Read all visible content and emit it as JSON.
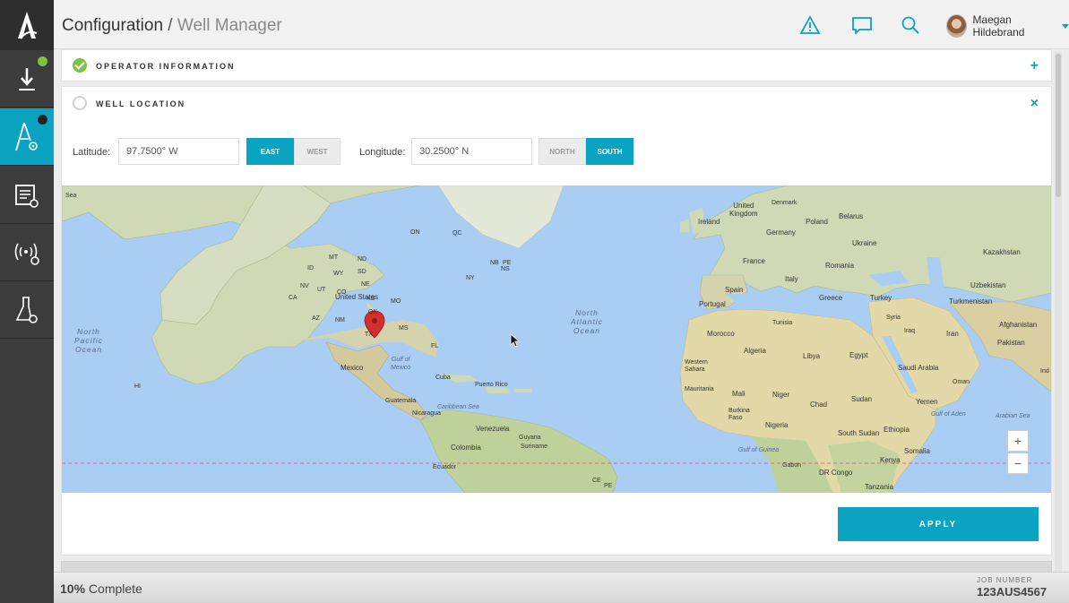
{
  "header": {
    "title_main": "Configuration",
    "title_sep": " / ",
    "title_sub": "Well Manager",
    "user_name": "Maegan Hildebrand",
    "icons": [
      "alert-icon",
      "message-icon",
      "search-icon"
    ]
  },
  "sidebar": {
    "items": [
      {
        "name": "download-icon",
        "status_dot": "#7dc243"
      },
      {
        "name": "rig-icon",
        "status_dot": "#222222",
        "active": true
      },
      {
        "name": "checklist-settings-icon"
      },
      {
        "name": "signal-settings-icon"
      },
      {
        "name": "flask-settings-icon"
      }
    ]
  },
  "sections": {
    "operator": {
      "title": "OPERATOR INFORMATION",
      "status": "complete",
      "toggle": "+"
    },
    "location": {
      "title": "WELL LOCATION",
      "status": "incomplete",
      "toggle": "×"
    }
  },
  "location": {
    "latitude_label": "Latitude:",
    "latitude_value": "97.7500° W",
    "east": "EAST",
    "west": "WEST",
    "ew_selected": "EAST",
    "longitude_label": "Longitude:",
    "longitude_value": "30.2500° N",
    "north": "NORTH",
    "south": "SOUTH",
    "ns_selected": "SOUTH",
    "apply_label": "APPLY"
  },
  "map": {
    "zoom_in": "+",
    "zoom_out": "−",
    "labels": {
      "sea_top_left": "Sea",
      "united_kingdom": "United\nKingdom",
      "denmark": "Denmark",
      "ireland": "Ireland",
      "poland": "Poland",
      "belarus": "Belarus",
      "germany": "Germany",
      "ukraine": "Ukraine",
      "france": "France",
      "romania": "Romania",
      "kazakhstan": "Kazakhstan",
      "spain": "Spain",
      "italy": "Italy",
      "portugal": "Portugal",
      "greece": "Greece",
      "turkey": "Turkey",
      "uzbekistan": "Uzbekistan",
      "turkmenistan": "Turkmenistan",
      "tunisia": "Tunisia",
      "syria": "Syria",
      "iraq": "Iraq",
      "iran": "Iran",
      "afghanistan": "Afghanistan",
      "pakistan": "Pakistan",
      "morocco": "Morocco",
      "algeria": "Algeria",
      "libya": "Libya",
      "egypt": "Egypt",
      "western_sahara": "Western\nSahara",
      "saudi_arabia": "Saudi Arabia",
      "oman": "Oman",
      "india": "Ind",
      "mauritania": "Mauritania",
      "mali": "Mali",
      "niger": "Niger",
      "sudan": "Sudan",
      "yemen": "Yemen",
      "chad": "Chad",
      "gulf_of_aden": "Gulf of Aden",
      "arabian_sea": "Arabian Sea",
      "burkina_faso": "Burkina\nFaso",
      "nigeria": "Nigeria",
      "ethiopia": "Ethiopia",
      "south_sudan": "South Sudan",
      "gulf_of_guinea": "Gulf of Guinea",
      "somalia": "Somalia",
      "gabon": "Gabon",
      "dr_congo": "DR Congo",
      "kenya": "Kenya",
      "tanzania": "Tanzania",
      "north_pacific_ocean": "North\nPacific\nOcean",
      "north_atlantic_ocean": "North\nAtlantic\nOcean",
      "united_states": "United States",
      "mexico": "Mexico",
      "gulf_of_mexico": "Gulf of\nMexico",
      "cuba": "Cuba",
      "puerto_rico": "Puerto Rico",
      "caribbean_sea": "Caribbean Sea",
      "guatemala": "Guatemala",
      "nicaragua": "Nicaragua",
      "venezuela": "Venezuela",
      "colombia": "Colombia",
      "guyana": "Guyana",
      "suriname": "Suriname",
      "ecuador": "Ecuador",
      "hi": "HI",
      "on": "ON",
      "qc": "QC",
      "tx": "TX",
      "nm": "NM",
      "fl": "FL",
      "ms": "MS",
      "ny": "NY",
      "nd": "ND",
      "sd": "SD",
      "ne": "NE",
      "ks": "KS",
      "ok": "OK",
      "mo": "MO",
      "az": "AZ",
      "ca": "CA",
      "nv": "NV",
      "ut": "UT",
      "co": "CO",
      "id": "ID",
      "mt": "MT",
      "wy": "WY",
      "nb": "NB",
      "ns": "NS",
      "pe": "PE",
      "ce": "CE",
      "pe_br": "PE"
    }
  },
  "footer": {
    "progress_percent": "10%",
    "progress_text": " Complete",
    "job_label": "JOB NUMBER",
    "job_value": "123AUS4567"
  }
}
